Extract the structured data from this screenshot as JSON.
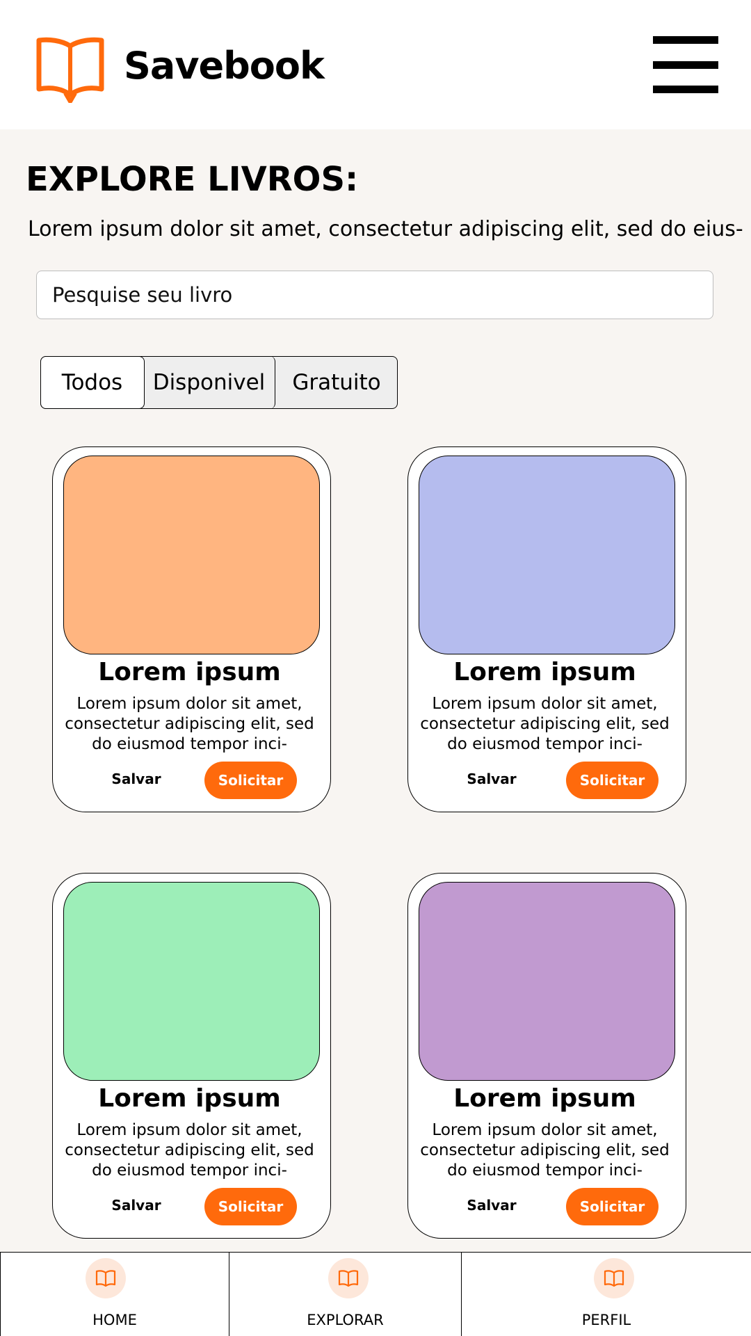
{
  "header": {
    "brand": "Savebook",
    "logo_icon": "open-book-icon",
    "menu_icon": "hamburger-menu-icon"
  },
  "main": {
    "title": "EXPLORE LIVROS:",
    "description": "Lorem ipsum dolor sit amet, consectetur adipiscing elit, sed do eius-",
    "search": {
      "placeholder": "Pesquise seu livro",
      "value": ""
    },
    "filters": [
      {
        "label": "Todos",
        "selected": true
      },
      {
        "label": "Disponivel",
        "selected": false
      },
      {
        "label": "Gratuito",
        "selected": false
      }
    ],
    "books": [
      {
        "title": "Lorem ipsum",
        "description": "Lorem ipsum dolor sit amet, consectetur adipiscing elit, sed do eiusmod tempor inci-",
        "cover_color": "#ffb580",
        "save_label": "Salvar",
        "request_label": "Solicitar"
      },
      {
        "title": "Lorem ipsum",
        "description": "Lorem ipsum dolor sit amet, consectetur adipiscing elit, sed do eiusmod tempor inci-",
        "cover_color": "#b5bcee",
        "save_label": "Salvar",
        "request_label": "Solicitar"
      },
      {
        "title": "Lorem ipsum",
        "description": "Lorem ipsum dolor sit amet, consectetur adipiscing elit, sed do eiusmod tempor inci-",
        "cover_color": "#9deeb8",
        "save_label": "Salvar",
        "request_label": "Solicitar"
      },
      {
        "title": "Lorem ipsum",
        "description": "Lorem ipsum dolor sit amet, consectetur adipiscing elit, sed do eiusmod tempor inci-",
        "cover_color": "#c19ad0",
        "save_label": "Salvar",
        "request_label": "Solicitar"
      }
    ]
  },
  "bottom_nav": [
    {
      "label": "HOME",
      "icon": "book-icon"
    },
    {
      "label": "EXPLORAR",
      "icon": "book-icon"
    },
    {
      "label": "PERFIL",
      "icon": "book-icon"
    }
  ],
  "colors": {
    "accent": "#ff6a0c",
    "background": "#f8f5f2",
    "nav_icon_bg": "#fde7da"
  }
}
